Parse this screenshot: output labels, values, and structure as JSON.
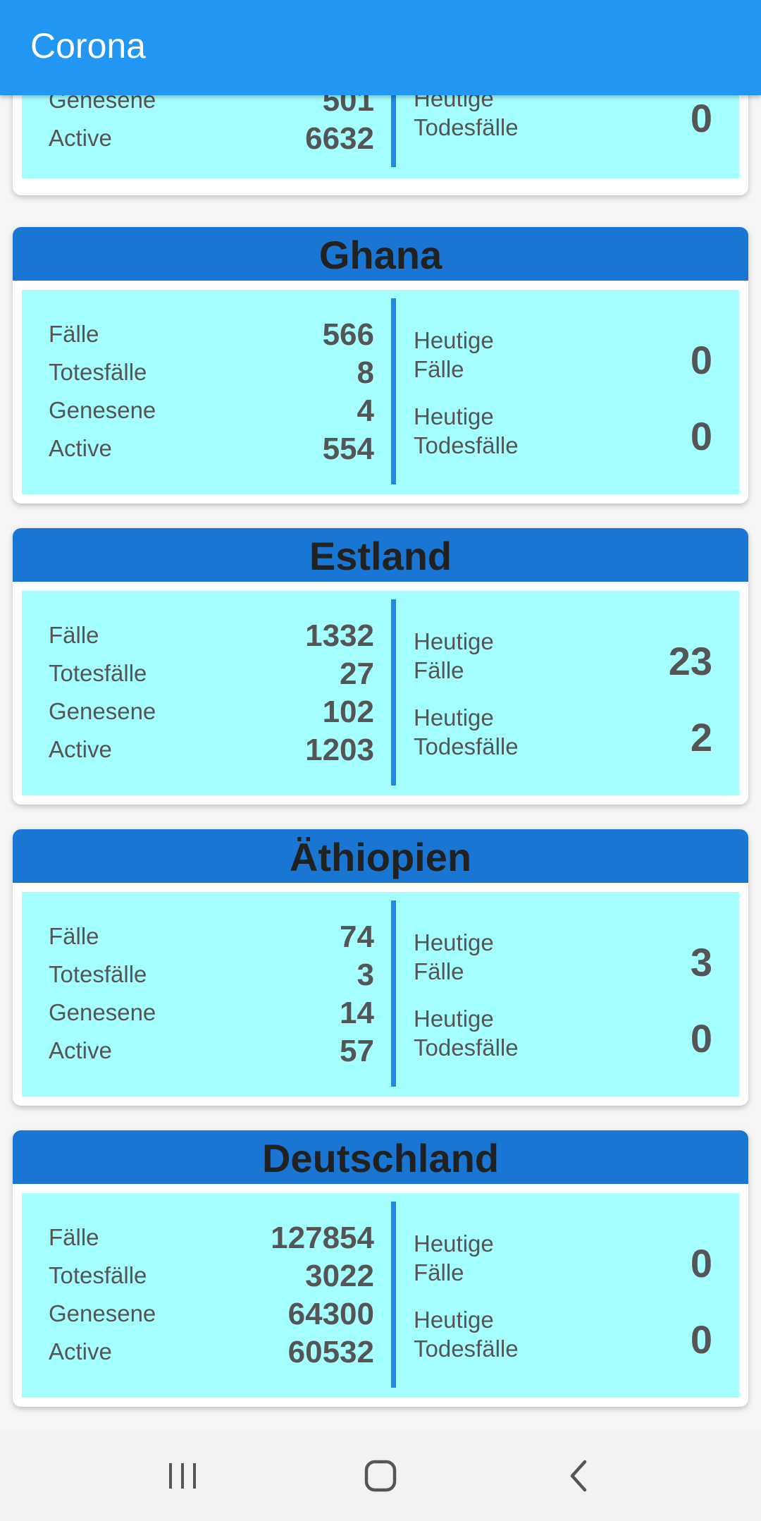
{
  "app": {
    "title": "Corona"
  },
  "top_card": {
    "left_stats": [
      {
        "label": "Genesene",
        "value": "501"
      },
      {
        "label": "Active",
        "value": "6632"
      }
    ],
    "today": [
      {
        "label_line1": "Heutige",
        "label_line2": "Todesfälle",
        "value": "0"
      }
    ]
  },
  "cards": [
    {
      "country": "Ghana",
      "left_stats": [
        {
          "label": "Fälle",
          "value": "566"
        },
        {
          "label": "Totesfälle",
          "value": "8"
        },
        {
          "label": "Genesene",
          "value": "4"
        },
        {
          "label": "Active",
          "value": "554"
        }
      ],
      "today": [
        {
          "label_line1": "Heutige",
          "label_line2": "Fälle",
          "value": "0"
        },
        {
          "label_line1": "Heutige",
          "label_line2": "Todesfälle",
          "value": "0"
        }
      ]
    },
    {
      "country": "Estland",
      "left_stats": [
        {
          "label": "Fälle",
          "value": "1332"
        },
        {
          "label": "Totesfälle",
          "value": "27"
        },
        {
          "label": "Genesene",
          "value": "102"
        },
        {
          "label": "Active",
          "value": "1203"
        }
      ],
      "today": [
        {
          "label_line1": "Heutige",
          "label_line2": "Fälle",
          "value": "23"
        },
        {
          "label_line1": "Heutige",
          "label_line2": "Todesfälle",
          "value": "2"
        }
      ]
    },
    {
      "country": "Äthiopien",
      "left_stats": [
        {
          "label": "Fälle",
          "value": "74"
        },
        {
          "label": "Totesfälle",
          "value": "3"
        },
        {
          "label": "Genesene",
          "value": "14"
        },
        {
          "label": "Active",
          "value": "57"
        }
      ],
      "today": [
        {
          "label_line1": "Heutige",
          "label_line2": "Fälle",
          "value": "3"
        },
        {
          "label_line1": "Heutige",
          "label_line2": "Todesfälle",
          "value": "0"
        }
      ]
    },
    {
      "country": "Deutschland",
      "left_stats": [
        {
          "label": "Fälle",
          "value": "127854"
        },
        {
          "label": "Totesfälle",
          "value": "3022"
        },
        {
          "label": "Genesene",
          "value": "64300"
        },
        {
          "label": "Active",
          "value": "60532"
        }
      ],
      "today": [
        {
          "label_line1": "Heutige",
          "label_line2": "Fälle",
          "value": "0"
        },
        {
          "label_line1": "Heutige",
          "label_line2": "Todesfälle",
          "value": "0"
        }
      ]
    }
  ],
  "nav": {
    "recents_icon": "recents-icon",
    "home_icon": "home-icon",
    "back_icon": "back-icon"
  },
  "colors": {
    "app_bar": "#2196f3",
    "card_header": "#1976d2",
    "card_body": "#a5fffe",
    "divider": "#1e88e5"
  }
}
